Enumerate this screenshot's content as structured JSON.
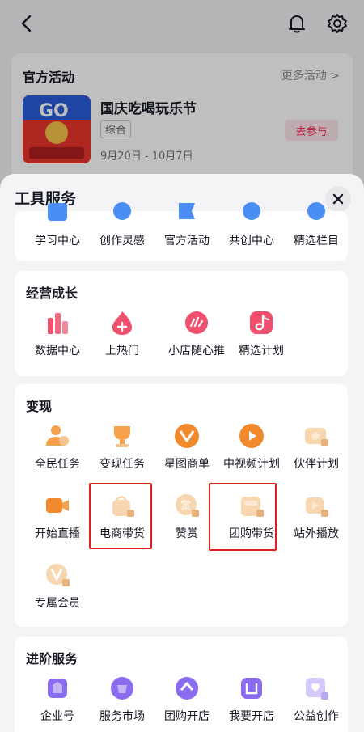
{
  "background": {
    "activity_section_title": "官方活动",
    "more_link": "更多活动 >",
    "event": {
      "name": "国庆吃喝玩乐节",
      "tag": "综合",
      "join_label": "去参与",
      "date": "9月20日 - 10月7日"
    }
  },
  "sheet": {
    "title": "工具服务",
    "top_row": [
      "学习中心",
      "创作灵感",
      "官方活动",
      "共创中心",
      "精选栏目"
    ],
    "growth": {
      "title": "经营成长",
      "items": [
        "数据中心",
        "上热门",
        "小店随心推",
        "精选计划"
      ]
    },
    "monetize": {
      "title": "变现",
      "items": [
        "全民任务",
        "变现任务",
        "星图商单",
        "中视频计划",
        "伙伴计划",
        "开始直播",
        "电商带货",
        "赞赏",
        "团购带货",
        "站外播放",
        "专属会员"
      ]
    },
    "advanced": {
      "title": "进阶服务",
      "items": [
        "企业号",
        "服务市场",
        "团购开店",
        "我要开店",
        "公益创作"
      ]
    }
  },
  "colors": {
    "accent": "#fe2c55",
    "highlight_box": "#e02020",
    "icon_orange": "#f5a04a",
    "icon_pink": "#f0506e",
    "icon_purple": "#8a6cf0"
  }
}
